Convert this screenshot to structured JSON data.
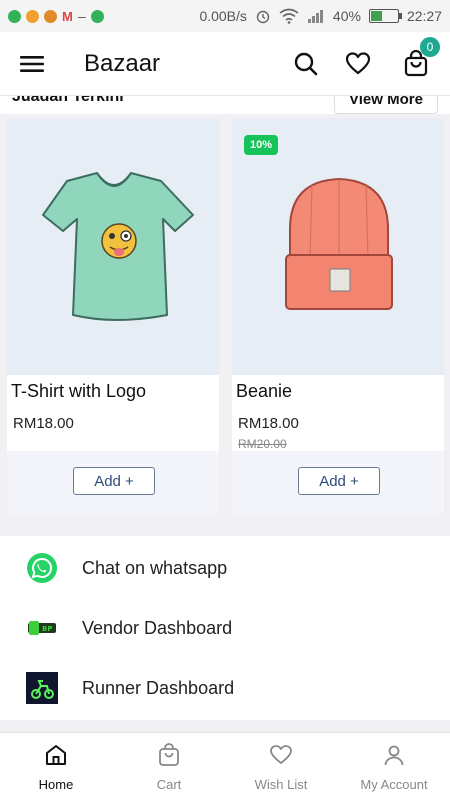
{
  "status_bar": {
    "network_speed": "0.00B/s",
    "battery_percent": "40%",
    "time": "22:27",
    "battery_level": 0.4
  },
  "app_bar": {
    "title": "Bazaar",
    "cart_count": "0"
  },
  "section": {
    "title": "Juadah Terkini",
    "view_more": "View More"
  },
  "products": [
    {
      "name": "T-Shirt with Logo",
      "price": "RM18.00",
      "add_label": "Add +",
      "image_icon": "tshirt-image"
    },
    {
      "name": "Beanie",
      "price": "RM18.00",
      "old_price": "RM20.00",
      "discount": "10%",
      "add_label": "Add +",
      "image_icon": "beanie-image"
    }
  ],
  "links": [
    {
      "label": "Chat on whatsapp",
      "icon": "whatsapp-icon"
    },
    {
      "label": "Vendor Dashboard",
      "icon": "vendor-icon"
    },
    {
      "label": "Runner Dashboard",
      "icon": "runner-icon"
    }
  ],
  "bottom_nav": [
    {
      "label": "Home",
      "icon": "home-icon",
      "active": true
    },
    {
      "label": "Cart",
      "icon": "cart-icon",
      "active": false
    },
    {
      "label": "Wish List",
      "icon": "heart-icon",
      "active": false
    },
    {
      "label": "My Account",
      "icon": "account-icon",
      "active": false
    }
  ],
  "colors": {
    "accent": "#1fa993",
    "discount": "#16c25a",
    "whatsapp": "#25d366",
    "button_text": "#2e4a7a"
  }
}
